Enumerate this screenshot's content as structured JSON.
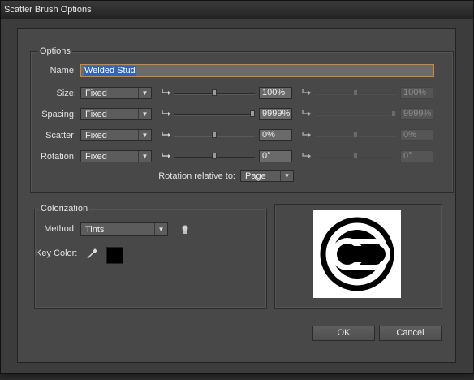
{
  "window": {
    "title": "Scatter Brush Options"
  },
  "options": {
    "group_label": "Options",
    "name_label": "Name:",
    "name_value": "Welded Stud",
    "rows": [
      {
        "label": "Size:",
        "method": "Fixed",
        "value1": "100%",
        "value2": "100%",
        "level1": 0.5,
        "level2": 0.5
      },
      {
        "label": "Spacing:",
        "method": "Fixed",
        "value1": "9999%",
        "value2": "9999%",
        "level1": 1.0,
        "level2": 1.0
      },
      {
        "label": "Scatter:",
        "method": "Fixed",
        "value1": "0%",
        "value2": "0%",
        "level1": 0.5,
        "level2": 0.5
      },
      {
        "label": "Rotation:",
        "method": "Fixed",
        "value1": "0°",
        "value2": "0°",
        "level1": 0.5,
        "level2": 0.5
      }
    ],
    "rotation_relative_label": "Rotation relative to:",
    "rotation_relative_value": "Page"
  },
  "colorization": {
    "group_label": "Colorization",
    "method_label": "Method:",
    "method_value": "Tints",
    "key_color_label": "Key Color:",
    "key_color": "#000000",
    "tips_icon": "lightbulb-icon",
    "eyedropper_icon": "eyedropper-icon"
  },
  "buttons": {
    "ok": "OK",
    "cancel": "Cancel"
  },
  "colors": {
    "name_border": "#d4882a",
    "selection": "#2f64b8"
  }
}
